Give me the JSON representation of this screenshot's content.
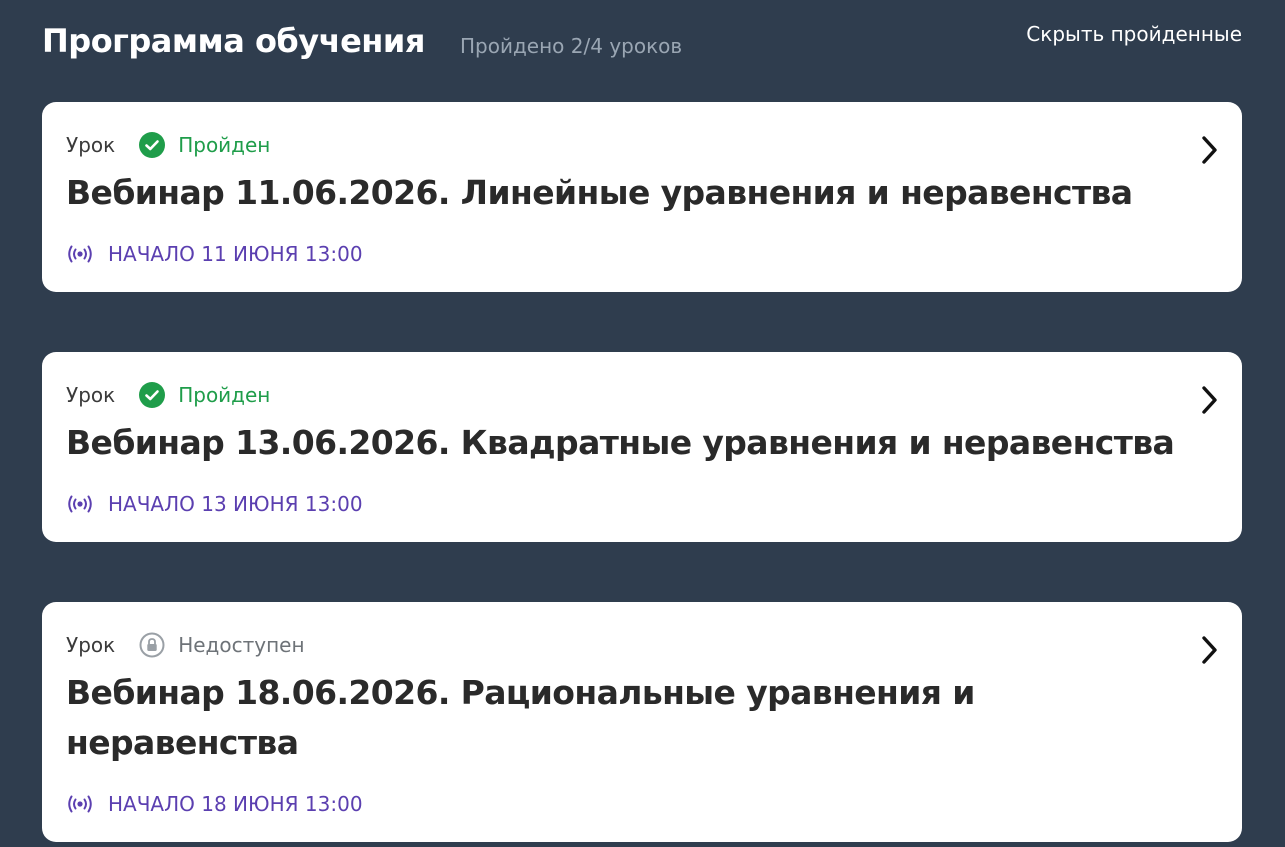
{
  "header": {
    "title": "Программа обучения",
    "progress": "Пройдено 2/4 уроков",
    "hide_completed": "Скрыть пройденные"
  },
  "lessons": [
    {
      "type_label": "Урок",
      "status": "Пройден",
      "status_icon": "check-circle-icon",
      "title": "Вебинар 11.06.2026. Линейные уравнения и неравенства",
      "start": "НАЧАЛО 11 ИЮНЯ 13:00"
    },
    {
      "type_label": "Урок",
      "status": "Пройден",
      "status_icon": "check-circle-icon",
      "title": "Вебинар 13.06.2026. Квадратные уравнения и неравенства",
      "start": "НАЧАЛО 13 ИЮНЯ 13:00"
    },
    {
      "type_label": "Урок",
      "status": "Недоступен",
      "status_icon": "lock-icon",
      "title": "Вебинар 18.06.2026. Рациональные уравнения и неравенства",
      "start": "НАЧАЛО 18 ИЮНЯ 13:00"
    }
  ],
  "colors": {
    "background": "#2f3d4e",
    "card": "#ffffff",
    "done": "#1f9d4a",
    "locked": "#6e7378",
    "start": "#5b3fb0"
  },
  "icons": {
    "live": "broadcast-icon",
    "open": "chevron-right-icon"
  }
}
